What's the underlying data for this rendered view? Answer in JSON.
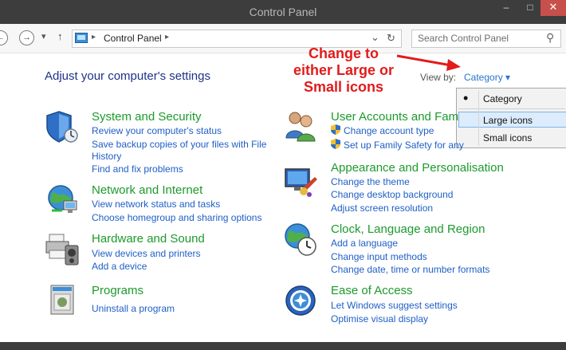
{
  "window": {
    "title": "Control Panel",
    "minimize": "–",
    "maximize": "□",
    "close": "✕"
  },
  "addressbar": {
    "back": "←",
    "forward": "→",
    "dropdown": "▾",
    "up": "↑",
    "path_sep1": "▸",
    "crumb": "Control Panel",
    "path_sep2": "▸",
    "history": "⌄",
    "refresh": "↻",
    "search_placeholder": "Search Control Panel",
    "search_icon": "⚲"
  },
  "page": {
    "heading": "Adjust your computer's settings",
    "view_by_label": "View by:",
    "view_by_value": "Category ▾"
  },
  "annotation": {
    "line1": "Change to",
    "line2": "either Large or",
    "line3": "Small icons",
    "color": "#e21b1b"
  },
  "view_menu": {
    "bullet": "•",
    "options": [
      "Category",
      "Large icons",
      "Small icons"
    ]
  },
  "categories": {
    "system": {
      "title": "System and Security",
      "links": [
        "Review your computer's status",
        "Save backup copies of your files with File",
        "History",
        "Find and fix problems"
      ]
    },
    "network": {
      "title": "Network and Internet",
      "links": [
        "View network status and tasks",
        "Choose homegroup and sharing options"
      ]
    },
    "hardware": {
      "title": "Hardware and Sound",
      "links": [
        "View devices and printers",
        "Add a device"
      ]
    },
    "programs": {
      "title": "Programs",
      "links": [
        "Uninstall a program"
      ]
    },
    "users": {
      "title": "User Accounts and Fam",
      "links": [
        "Change account type",
        "Set up Family Safety for any"
      ]
    },
    "appearance": {
      "title": "Appearance and Personalisation",
      "links": [
        "Change the theme",
        "Change desktop background",
        "Adjust screen resolution"
      ]
    },
    "clock": {
      "title": "Clock, Language and Region",
      "links": [
        "Add a language",
        "Change input methods",
        "Change date, time or number formats"
      ]
    },
    "ease": {
      "title": "Ease of Access",
      "links": [
        "Let Windows suggest settings",
        "Optimise visual display"
      ]
    }
  },
  "colors": {
    "category_title": "#1c9a2d",
    "link": "#1f5fc6",
    "heading": "#1e3287",
    "titlebar": "#3d3d3d"
  }
}
